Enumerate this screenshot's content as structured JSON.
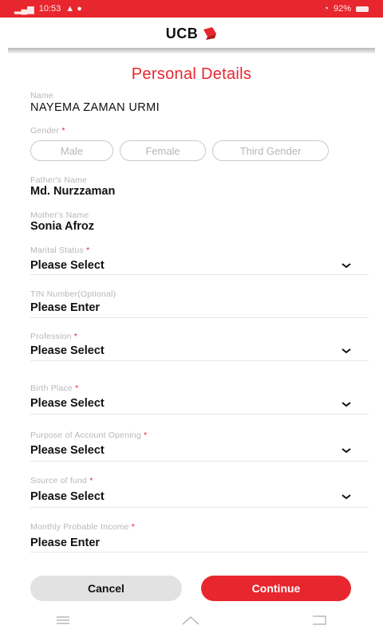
{
  "status_bar": {
    "time": "10:53",
    "battery_percent": "92%"
  },
  "header": {
    "logo_text": "UCB"
  },
  "page_title": "Personal Details",
  "fields": {
    "name": {
      "label": "Name",
      "value": "NAYEMA ZAMAN URMI"
    },
    "gender": {
      "label": "Gender",
      "required": true,
      "options": [
        "Male",
        "Female",
        "Third Gender"
      ]
    },
    "father_name": {
      "label": "Father's Name",
      "value": "Md. Nurzzaman"
    },
    "mother_name": {
      "label": "Mother's Name",
      "value": "Sonia Afroz"
    },
    "marital_status": {
      "label": "Marital Status",
      "required": true,
      "value": "Please Select"
    },
    "tin_number": {
      "label": "TIN Number(Optional)",
      "value": "Please Enter"
    },
    "profession": {
      "label": "Profession",
      "required": true,
      "value": "Please Select"
    },
    "birth_place": {
      "label": "Birth Place",
      "required": true,
      "value": "Please Select"
    },
    "purpose": {
      "label": "Purpose of Account Opening",
      "required": true,
      "value": "Please Select"
    },
    "source_of_fund": {
      "label": "Source of fund",
      "required": true,
      "value": "Please Select"
    },
    "monthly_income": {
      "label": "Monthly Probable Income",
      "required": true,
      "value": "Please Enter"
    }
  },
  "buttons": {
    "cancel": "Cancel",
    "continue": "Continue"
  },
  "colors": {
    "brand_red": "#e8262e",
    "label_gray": "#b7b7b7"
  }
}
